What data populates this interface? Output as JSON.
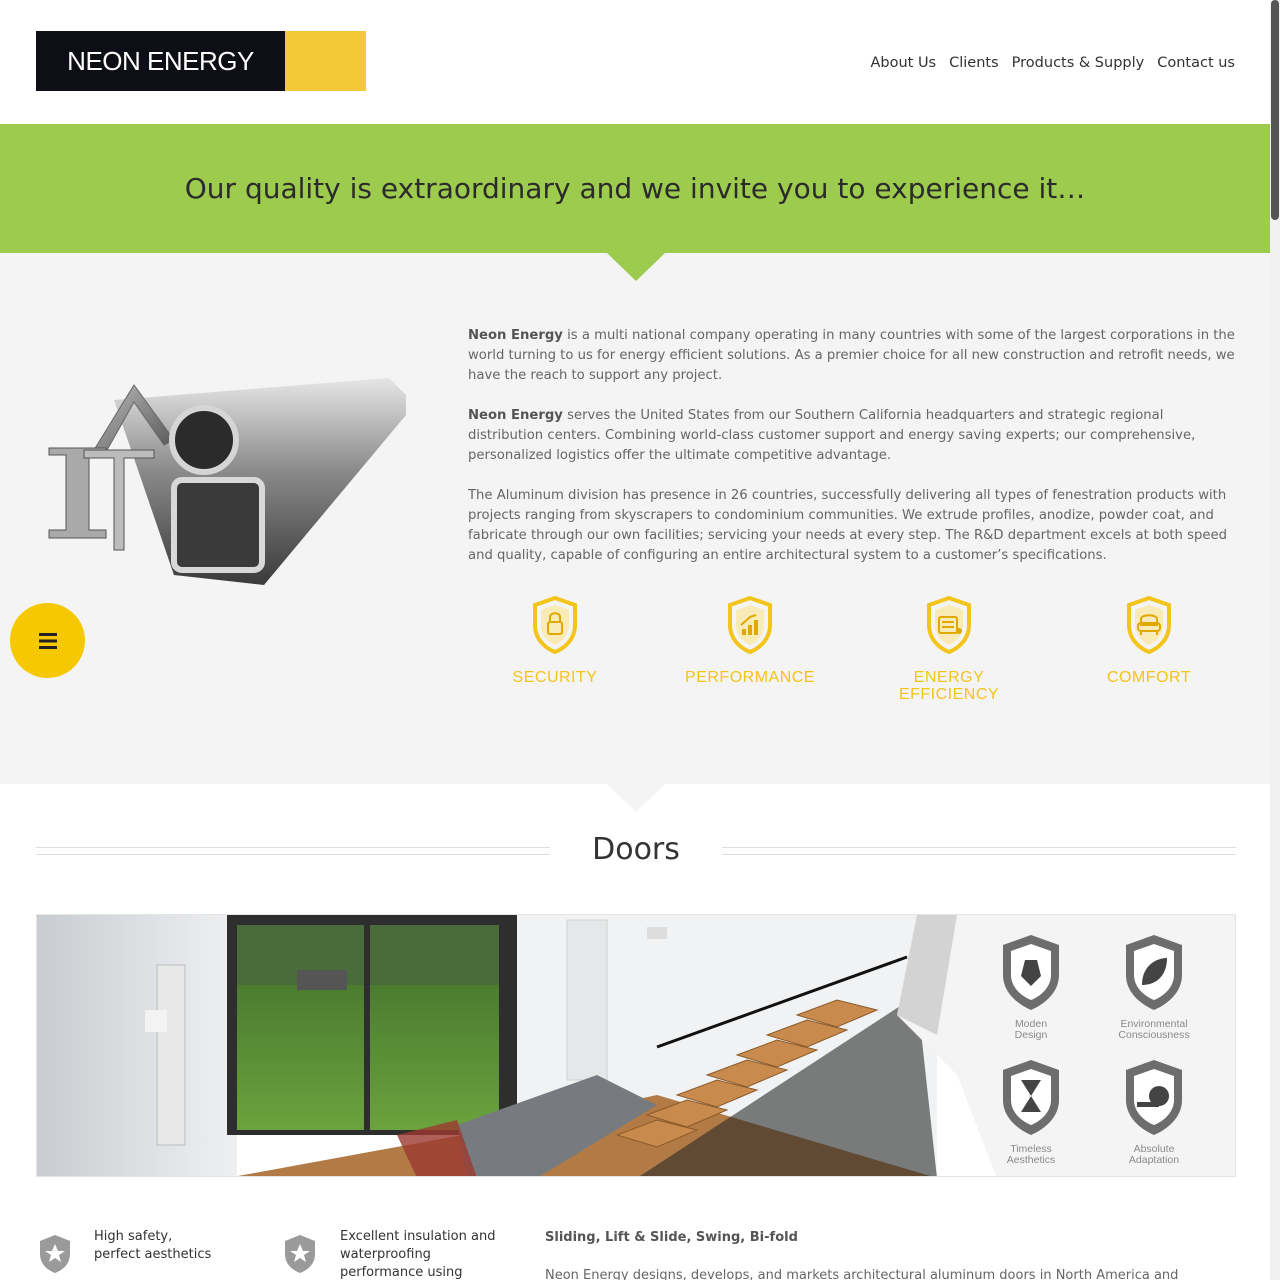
{
  "header": {
    "logo_text": "NEON ENERGY",
    "nav": [
      "About Us",
      "Clients",
      "Products & Supply",
      "Contact us"
    ]
  },
  "banner": {
    "headline": "Our quality is extraordinary and we invite you to experience it…"
  },
  "about": {
    "p1_bold": "Neon Energy",
    "p1_rest": " is a multi national company operating in many countries with some of the largest corporations in the world turning to us for energy efficient solutions. As a premier choice for all new construction and retrofit needs, we have the reach to support any project.",
    "p2_bold": "Neon Energy",
    "p2_rest": " serves the United States from our Southern California headquarters and strategic regional distribution centers. Combining world-class customer support and energy saving experts; our comprehensive, personalized logistics offer the ultimate competitive advantage.",
    "p3": "The Aluminum division has presence in 26 countries, successfully delivering all types of fenestration products with projects ranging from skyscrapers to condominium communities. We extrude profiles, anodize, powder coat, and fabricate through our own facilities; servicing your needs at every step. The R&D department excels at both speed and quality, capable of configuring an entire architectural system to a customer’s specifications."
  },
  "features": [
    {
      "label": "SECURITY",
      "icon": "lock-shield-icon"
    },
    {
      "label": "PERFORMANCE",
      "icon": "chart-shield-icon"
    },
    {
      "label": "ENERGY EFFICIENCY",
      "label_line1": "ENERGY",
      "label_line2": "EFFICIENCY",
      "icon": "battery-shield-icon"
    },
    {
      "label": "COMFORT",
      "icon": "armchair-shield-icon"
    }
  ],
  "doors": {
    "title": "Doors",
    "badges": [
      {
        "line1": "Moden",
        "line2": "Design",
        "icon": "pen-nib-shield-icon"
      },
      {
        "line1": "Environmental",
        "line2": "Consciousness",
        "icon": "leaf-shield-icon"
      },
      {
        "line1": "Timeless",
        "line2": "Aesthetics",
        "icon": "hourglass-shield-icon"
      },
      {
        "line1": "Absolute",
        "line2": "Adaptation",
        "icon": "tape-measure-shield-icon"
      }
    ]
  },
  "bottom": {
    "feat1_line1": "High safety,",
    "feat1_line2": "perfect aesthetics",
    "feat2_line1": "Excellent insulation and",
    "feat2_line2": "waterproofing",
    "feat2_line3": "performance using",
    "types_title": "Sliding, Lift & Slide, Swing, Bi-fold",
    "para": "Neon Energy designs, develops, and markets architectural aluminum doors in North America and"
  },
  "colors": {
    "banner_green": "#9dcb4d",
    "accent_yellow": "#f3c41a",
    "logo_dark": "#0d0e16"
  }
}
